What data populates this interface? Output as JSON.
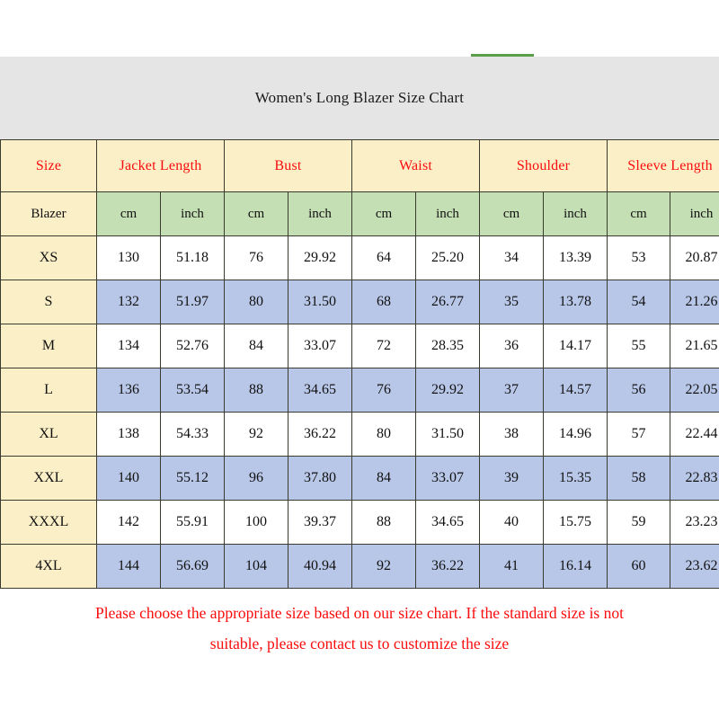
{
  "title": "Women's Long Blazer Size Chart",
  "accents": {
    "header_text": "#fa0d0d",
    "note_text": "#fa0d0d",
    "header_bg": "#fbefc8",
    "units_bg": "#c5dfb5",
    "row_alt_bg": "#b8c7e8",
    "title_band_bg": "#e5e5e5",
    "green_rule": "#5a9e48",
    "border": "#3a3a2e"
  },
  "table": {
    "size_header": "Size",
    "size_subheader": "Blazer",
    "groups": [
      "Jacket Length",
      "Bust",
      "Waist",
      "Shoulder",
      "Sleeve Length"
    ],
    "units": [
      "cm",
      "inch",
      "cm",
      "inch",
      "cm",
      "inch",
      "cm",
      "inch",
      "cm",
      "inch"
    ],
    "rows": [
      {
        "size": "XS",
        "values": [
          "130",
          "51.18",
          "76",
          "29.92",
          "64",
          "25.20",
          "34",
          "13.39",
          "53",
          "20.87"
        ]
      },
      {
        "size": "S",
        "values": [
          "132",
          "51.97",
          "80",
          "31.50",
          "68",
          "26.77",
          "35",
          "13.78",
          "54",
          "21.26"
        ]
      },
      {
        "size": "M",
        "values": [
          "134",
          "52.76",
          "84",
          "33.07",
          "72",
          "28.35",
          "36",
          "14.17",
          "55",
          "21.65"
        ]
      },
      {
        "size": "L",
        "values": [
          "136",
          "53.54",
          "88",
          "34.65",
          "76",
          "29.92",
          "37",
          "14.57",
          "56",
          "22.05"
        ]
      },
      {
        "size": "XL",
        "values": [
          "138",
          "54.33",
          "92",
          "36.22",
          "80",
          "31.50",
          "38",
          "14.96",
          "57",
          "22.44"
        ]
      },
      {
        "size": "XXL",
        "values": [
          "140",
          "55.12",
          "96",
          "37.80",
          "84",
          "33.07",
          "39",
          "15.35",
          "58",
          "22.83"
        ]
      },
      {
        "size": "XXXL",
        "values": [
          "142",
          "55.91",
          "100",
          "39.37",
          "88",
          "34.65",
          "40",
          "15.75",
          "59",
          "23.23"
        ]
      },
      {
        "size": "4XL",
        "values": [
          "144",
          "56.69",
          "104",
          "40.94",
          "92",
          "36.22",
          "41",
          "16.14",
          "60",
          "23.62"
        ]
      }
    ]
  },
  "note": {
    "line1": "Please choose the appropriate size based on our size chart. If the standard size is not",
    "line2": "suitable, please contact us to customize the size"
  }
}
